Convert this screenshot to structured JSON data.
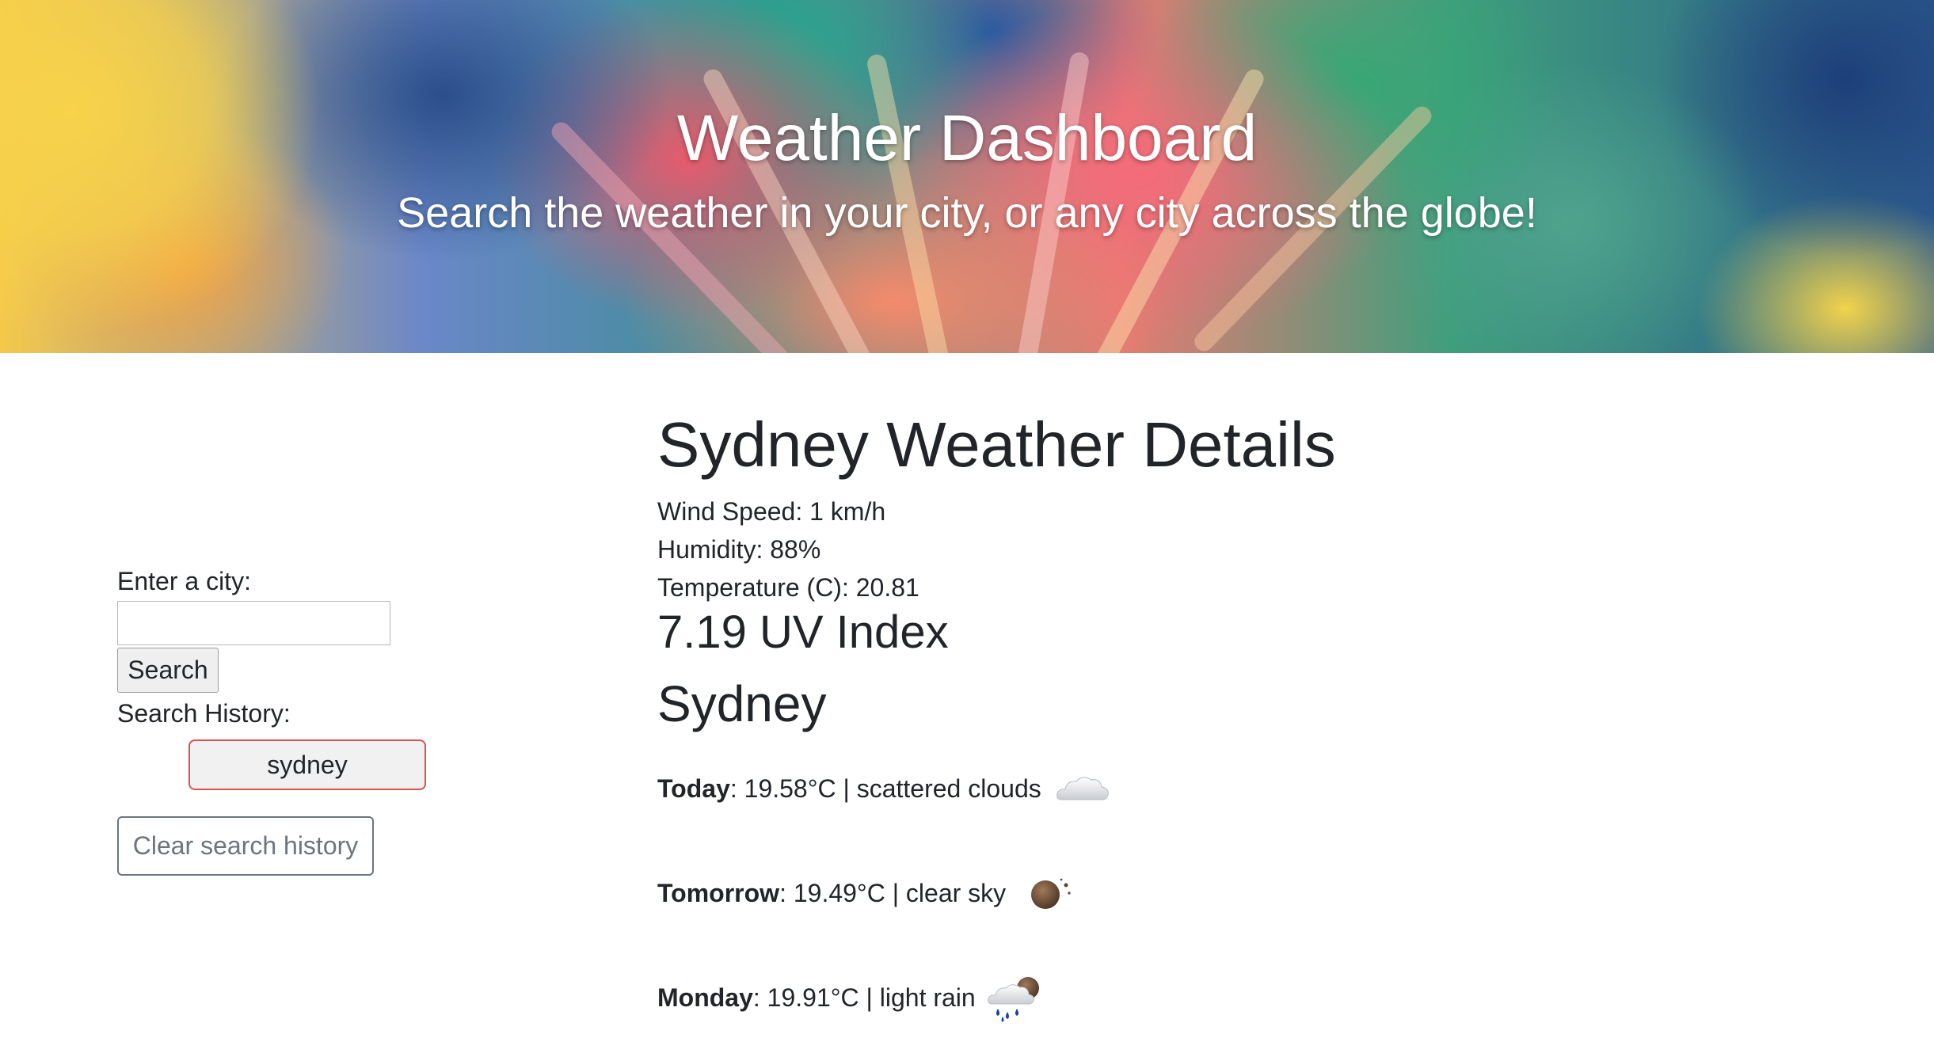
{
  "header": {
    "title": "Weather Dashboard",
    "subtitle": "Search the weather in your city, or any city across the globe!"
  },
  "search": {
    "label": "Enter a city:",
    "input_value": "",
    "button_label": "Search",
    "history_label": "Search History:",
    "history_items": [
      "sydney"
    ],
    "clear_label": "Clear search history"
  },
  "details": {
    "title": "Sydney Weather Details",
    "wind_speed": "Wind Speed: 1 km/h",
    "humidity": "Humidity: 88%",
    "temperature": "Temperature (C): 20.81",
    "uv_index": "7.19 UV Index",
    "city": "Sydney"
  },
  "forecast": [
    {
      "day": "Today",
      "summary": ": 19.58°C | scattered clouds",
      "icon": "cloud-icon"
    },
    {
      "day": "Tomorrow",
      "summary": ": 19.49°C | clear sky",
      "icon": "clear-sky-night-icon"
    },
    {
      "day": "Monday",
      "summary": ": 19.91°C | light rain",
      "icon": "rain-icon"
    }
  ],
  "colors": {
    "history_border": "#d9534f",
    "clear_button": "#6c757d",
    "text": "#212529"
  }
}
